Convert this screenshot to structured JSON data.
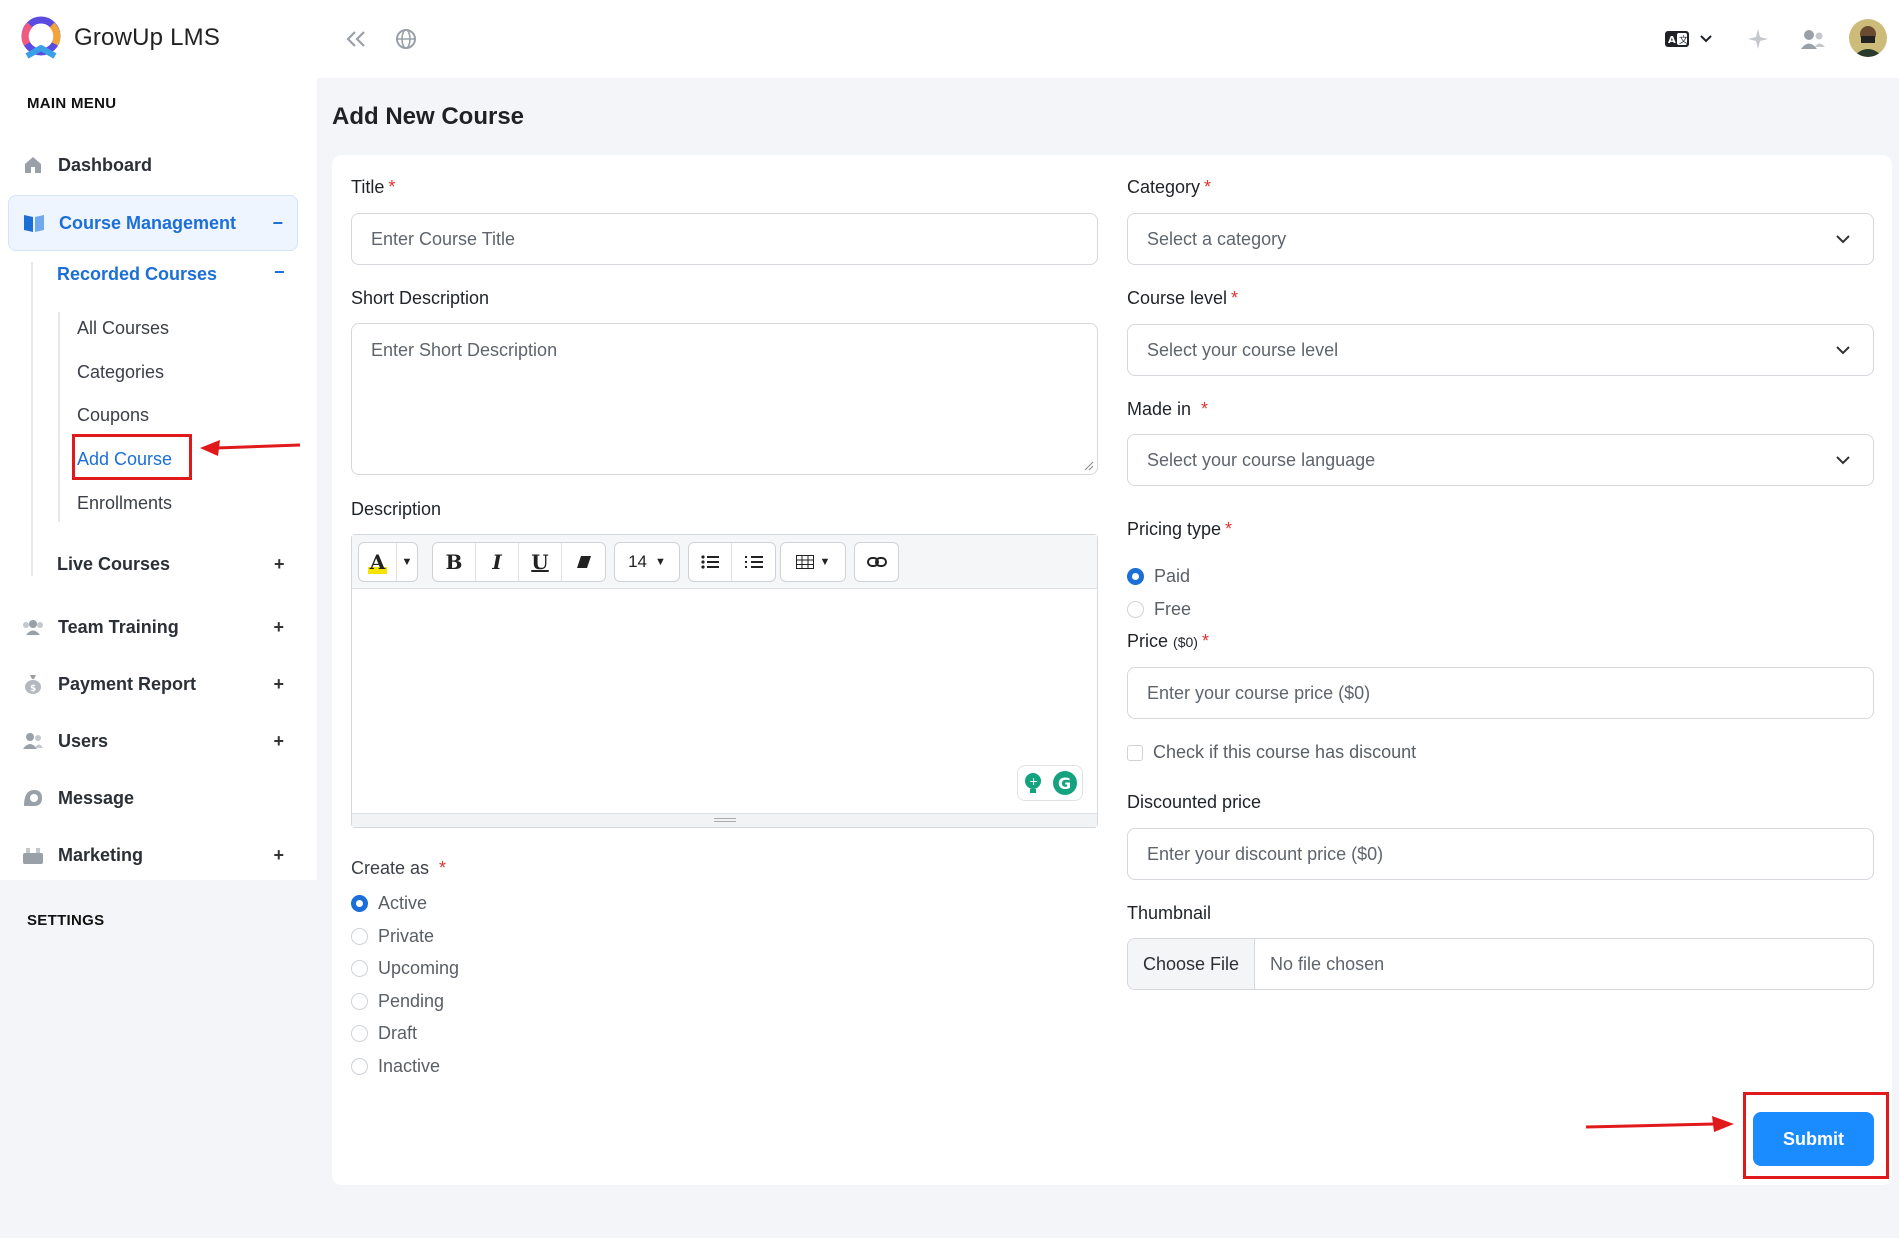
{
  "app": {
    "name": "GrowUp LMS"
  },
  "sidebar": {
    "main_menu_heading": "MAIN MENU",
    "settings_heading": "SETTINGS",
    "items": [
      {
        "label": "Dashboard",
        "icon": "home-icon",
        "toggle": ""
      },
      {
        "label": "Course Management",
        "icon": "book-icon",
        "toggle": "−"
      },
      {
        "label": "Live Courses",
        "icon": "",
        "toggle": "+"
      },
      {
        "label": "Team Training",
        "icon": "team-icon",
        "toggle": "+"
      },
      {
        "label": "Payment Report",
        "icon": "money-bag-icon",
        "toggle": "+"
      },
      {
        "label": "Users",
        "icon": "users-icon",
        "toggle": "+"
      },
      {
        "label": "Message",
        "icon": "message-icon",
        "toggle": ""
      },
      {
        "label": "Marketing",
        "icon": "marketing-icon",
        "toggle": "+"
      }
    ],
    "recorded_courses": {
      "label": "Recorded Courses",
      "toggle": "−"
    },
    "sub_items": [
      "All Courses",
      "Categories",
      "Coupons",
      "Add Course",
      "Enrollments"
    ],
    "active_sub_item": "Add Course"
  },
  "topbar": {
    "icons": [
      "collapse-icon",
      "globe-icon",
      "translate-icon",
      "chevron-down-icon",
      "sparkle-icon",
      "users-icon",
      "avatar"
    ]
  },
  "page": {
    "title": "Add New Course"
  },
  "form": {
    "title": {
      "label": "Title",
      "placeholder": "Enter Course Title"
    },
    "short_description": {
      "label": "Short Description",
      "placeholder": "Enter Short Description"
    },
    "description": {
      "label": "Description",
      "font_size": "14"
    },
    "create_as": {
      "label": "Create as",
      "options": [
        "Active",
        "Private",
        "Upcoming",
        "Pending",
        "Draft",
        "Inactive"
      ],
      "selected": "Active"
    },
    "category": {
      "label": "Category",
      "placeholder": "Select a category"
    },
    "course_level": {
      "label": "Course level",
      "placeholder": "Select your course level"
    },
    "made_in": {
      "label": "Made in",
      "placeholder": "Select your course language"
    },
    "pricing_type": {
      "label": "Pricing type",
      "options": [
        "Paid",
        "Free"
      ],
      "selected": "Paid"
    },
    "price": {
      "label": "Price",
      "unit": "($0)",
      "placeholder": "Enter your course price ($0)"
    },
    "discount_check": {
      "label": "Check if this course has discount"
    },
    "discounted_price": {
      "label": "Discounted price",
      "placeholder": "Enter your discount price ($0)"
    },
    "thumbnail": {
      "label": "Thumbnail",
      "button": "Choose File",
      "status": "No file chosen"
    },
    "submit": {
      "label": "Submit"
    }
  },
  "colors": {
    "accent": "#1b6fd6",
    "submit": "#1a8cff",
    "annotation": "#e0191b",
    "required": "#e0322f"
  }
}
